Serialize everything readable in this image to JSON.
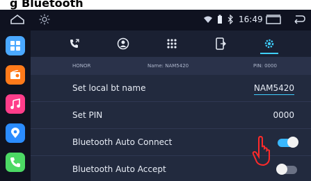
{
  "caption": "g Bluetooth",
  "status": {
    "time": "16:49",
    "icons": [
      "home-icon",
      "brightness-icon",
      "wifi-icon",
      "battery-icon",
      "bluetooth-icon",
      "window-icon",
      "back-icon"
    ]
  },
  "sidebar": {
    "apps": [
      {
        "name": "app-grid-icon",
        "color": "#4aa8ff"
      },
      {
        "name": "radio-icon",
        "color": "#ff7a1a"
      },
      {
        "name": "music-icon",
        "color": "#ff3d8a"
      },
      {
        "name": "navigation-icon",
        "color": "#2b8cff"
      },
      {
        "name": "phone-icon",
        "color": "#4cd964"
      }
    ]
  },
  "tabs": [
    "call-log-icon",
    "contacts-icon",
    "dialpad-icon",
    "phone-transfer-icon",
    "settings-icon"
  ],
  "info": {
    "device": "HONOR",
    "name": "Name: NAM5420",
    "pin": "PIN: 0000"
  },
  "settings": [
    {
      "label": "Set local bt name",
      "value": "NAM5420"
    },
    {
      "label": "Set PIN",
      "value": "0000"
    },
    {
      "label": "Bluetooth Auto Connect",
      "on": true
    },
    {
      "label": "Bluetooth Auto Accept",
      "on": false
    }
  ],
  "colors": {
    "accent": "#3fd0ff",
    "toggle_on": "#39b8ff",
    "toggle_off": "#6b7285",
    "hand": "#ff2a2a"
  }
}
